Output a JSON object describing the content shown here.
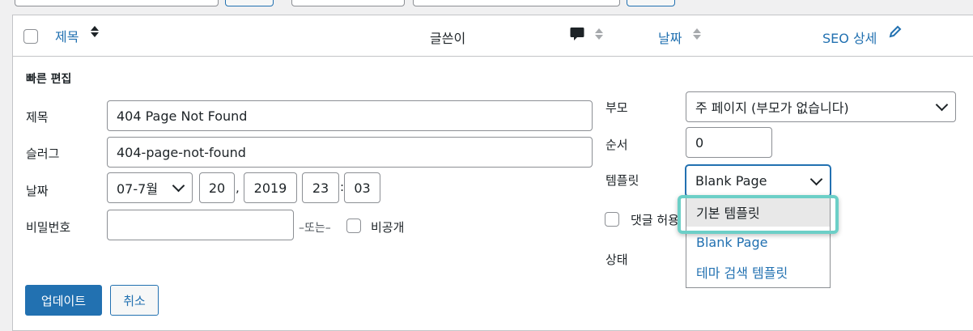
{
  "table_header": {
    "title": "제목",
    "author": "글쓴이",
    "date": "날짜",
    "seo": "SEO 상세"
  },
  "quick_edit": {
    "heading": "빠른 편집",
    "title_label": "제목",
    "title_value": "404 Page Not Found",
    "slug_label": "슬러그",
    "slug_value": "404-page-not-found",
    "date_label": "날짜",
    "month_value": "07-7월",
    "day_value": "20",
    "year_value": "2019",
    "hour_value": "23",
    "minute_value": "03",
    "sep_comma": ",",
    "sep_colon": ":",
    "password_label": "비밀번호",
    "or_text": "–또는–",
    "private_label": "비공개",
    "parent_label": "부모",
    "parent_value": "주 페이지 (부모가 없습니다)",
    "order_label": "순서",
    "order_value": "0",
    "template_label": "템플릿",
    "template_value": "Blank Page",
    "comments_label": "댓글 허용",
    "status_label": "상태",
    "update_button": "업데이트",
    "cancel_button": "취소"
  },
  "template_dropdown": {
    "options": [
      "기본 템플릿",
      "Blank Page",
      "테마 검색 템플릿"
    ],
    "highlighted_index": 0
  },
  "colors": {
    "accent": "#2271b1",
    "highlight_ring": "#6ccfc7"
  },
  "icons": {
    "comment": "comment-bubble-icon",
    "sort": "sort-arrows-icon",
    "edit": "pencil-icon",
    "chevron": "chevron-down-icon"
  }
}
